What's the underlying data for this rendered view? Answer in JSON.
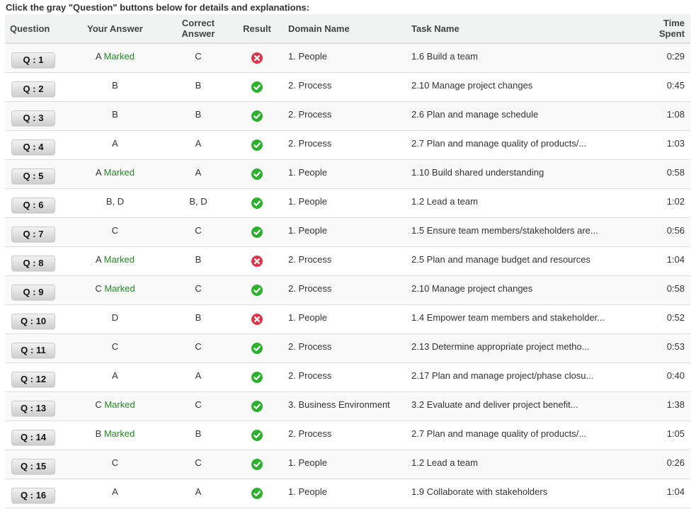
{
  "instruction": "Click the gray \"Question\" buttons below for details and explanations:",
  "colors": {
    "marked": "#228b22",
    "correct": "#2db02d",
    "incorrect": "#e0334a"
  },
  "table": {
    "headers": {
      "question": "Question",
      "your_answer": "Your Answer",
      "correct_answer": "Correct Answer",
      "result": "Result",
      "domain_name": "Domain Name",
      "task_name": "Task Name",
      "time_spent": "Time Spent"
    },
    "marked_label": "Marked",
    "rows": [
      {
        "question": "Q : 1",
        "answer": "A",
        "marked": true,
        "correct": "C",
        "result": "incorrect",
        "domain": "1. People",
        "task": "1.6 Build a team",
        "time": "0:29"
      },
      {
        "question": "Q : 2",
        "answer": "B",
        "marked": false,
        "correct": "B",
        "result": "correct",
        "domain": "2. Process",
        "task": "2.10 Manage project changes",
        "time": "0:45"
      },
      {
        "question": "Q : 3",
        "answer": "B",
        "marked": false,
        "correct": "B",
        "result": "correct",
        "domain": "2. Process",
        "task": "2.6 Plan and manage schedule",
        "time": "1:08"
      },
      {
        "question": "Q : 4",
        "answer": "A",
        "marked": false,
        "correct": "A",
        "result": "correct",
        "domain": "2. Process",
        "task": "2.7 Plan and manage quality of products/...",
        "time": "1:03"
      },
      {
        "question": "Q : 5",
        "answer": "A",
        "marked": true,
        "correct": "A",
        "result": "correct",
        "domain": "1. People",
        "task": "1.10 Build shared understanding",
        "time": "0:58"
      },
      {
        "question": "Q : 6",
        "answer": "B, D",
        "marked": false,
        "correct": "B, D",
        "result": "correct",
        "domain": "1. People",
        "task": "1.2 Lead a team",
        "time": "1:02"
      },
      {
        "question": "Q : 7",
        "answer": "C",
        "marked": false,
        "correct": "C",
        "result": "correct",
        "domain": "1. People",
        "task": "1.5 Ensure team members/stakeholders are...",
        "time": "0:56"
      },
      {
        "question": "Q : 8",
        "answer": "A",
        "marked": true,
        "correct": "B",
        "result": "incorrect",
        "domain": "2. Process",
        "task": "2.5 Plan and manage budget and resources",
        "time": "1:04"
      },
      {
        "question": "Q : 9",
        "answer": "C",
        "marked": true,
        "correct": "C",
        "result": "correct",
        "domain": "2. Process",
        "task": "2.10 Manage project changes",
        "time": "0:58"
      },
      {
        "question": "Q : 10",
        "answer": "D",
        "marked": false,
        "correct": "B",
        "result": "incorrect",
        "domain": "1. People",
        "task": "1.4 Empower team members and stakeholder...",
        "time": "0:52"
      },
      {
        "question": "Q : 11",
        "answer": "C",
        "marked": false,
        "correct": "C",
        "result": "correct",
        "domain": "2. Process",
        "task": "2.13 Determine appropriate project metho...",
        "time": "0:53"
      },
      {
        "question": "Q : 12",
        "answer": "A",
        "marked": false,
        "correct": "A",
        "result": "correct",
        "domain": "2. Process",
        "task": "2.17 Plan and manage project/phase closu...",
        "time": "0:40"
      },
      {
        "question": "Q : 13",
        "answer": "C",
        "marked": true,
        "correct": "C",
        "result": "correct",
        "domain": "3. Business Environment",
        "task": "3.2 Evaluate and deliver project benefit...",
        "time": "1:38"
      },
      {
        "question": "Q : 14",
        "answer": "B",
        "marked": true,
        "correct": "B",
        "result": "correct",
        "domain": "2. Process",
        "task": "2.7 Plan and manage quality of products/...",
        "time": "1:05"
      },
      {
        "question": "Q : 15",
        "answer": "C",
        "marked": false,
        "correct": "C",
        "result": "correct",
        "domain": "1. People",
        "task": "1.2 Lead a team",
        "time": "0:26"
      },
      {
        "question": "Q : 16",
        "answer": "A",
        "marked": false,
        "correct": "A",
        "result": "correct",
        "domain": "1. People",
        "task": "1.9 Collaborate with stakeholders",
        "time": "1:04"
      }
    ]
  }
}
